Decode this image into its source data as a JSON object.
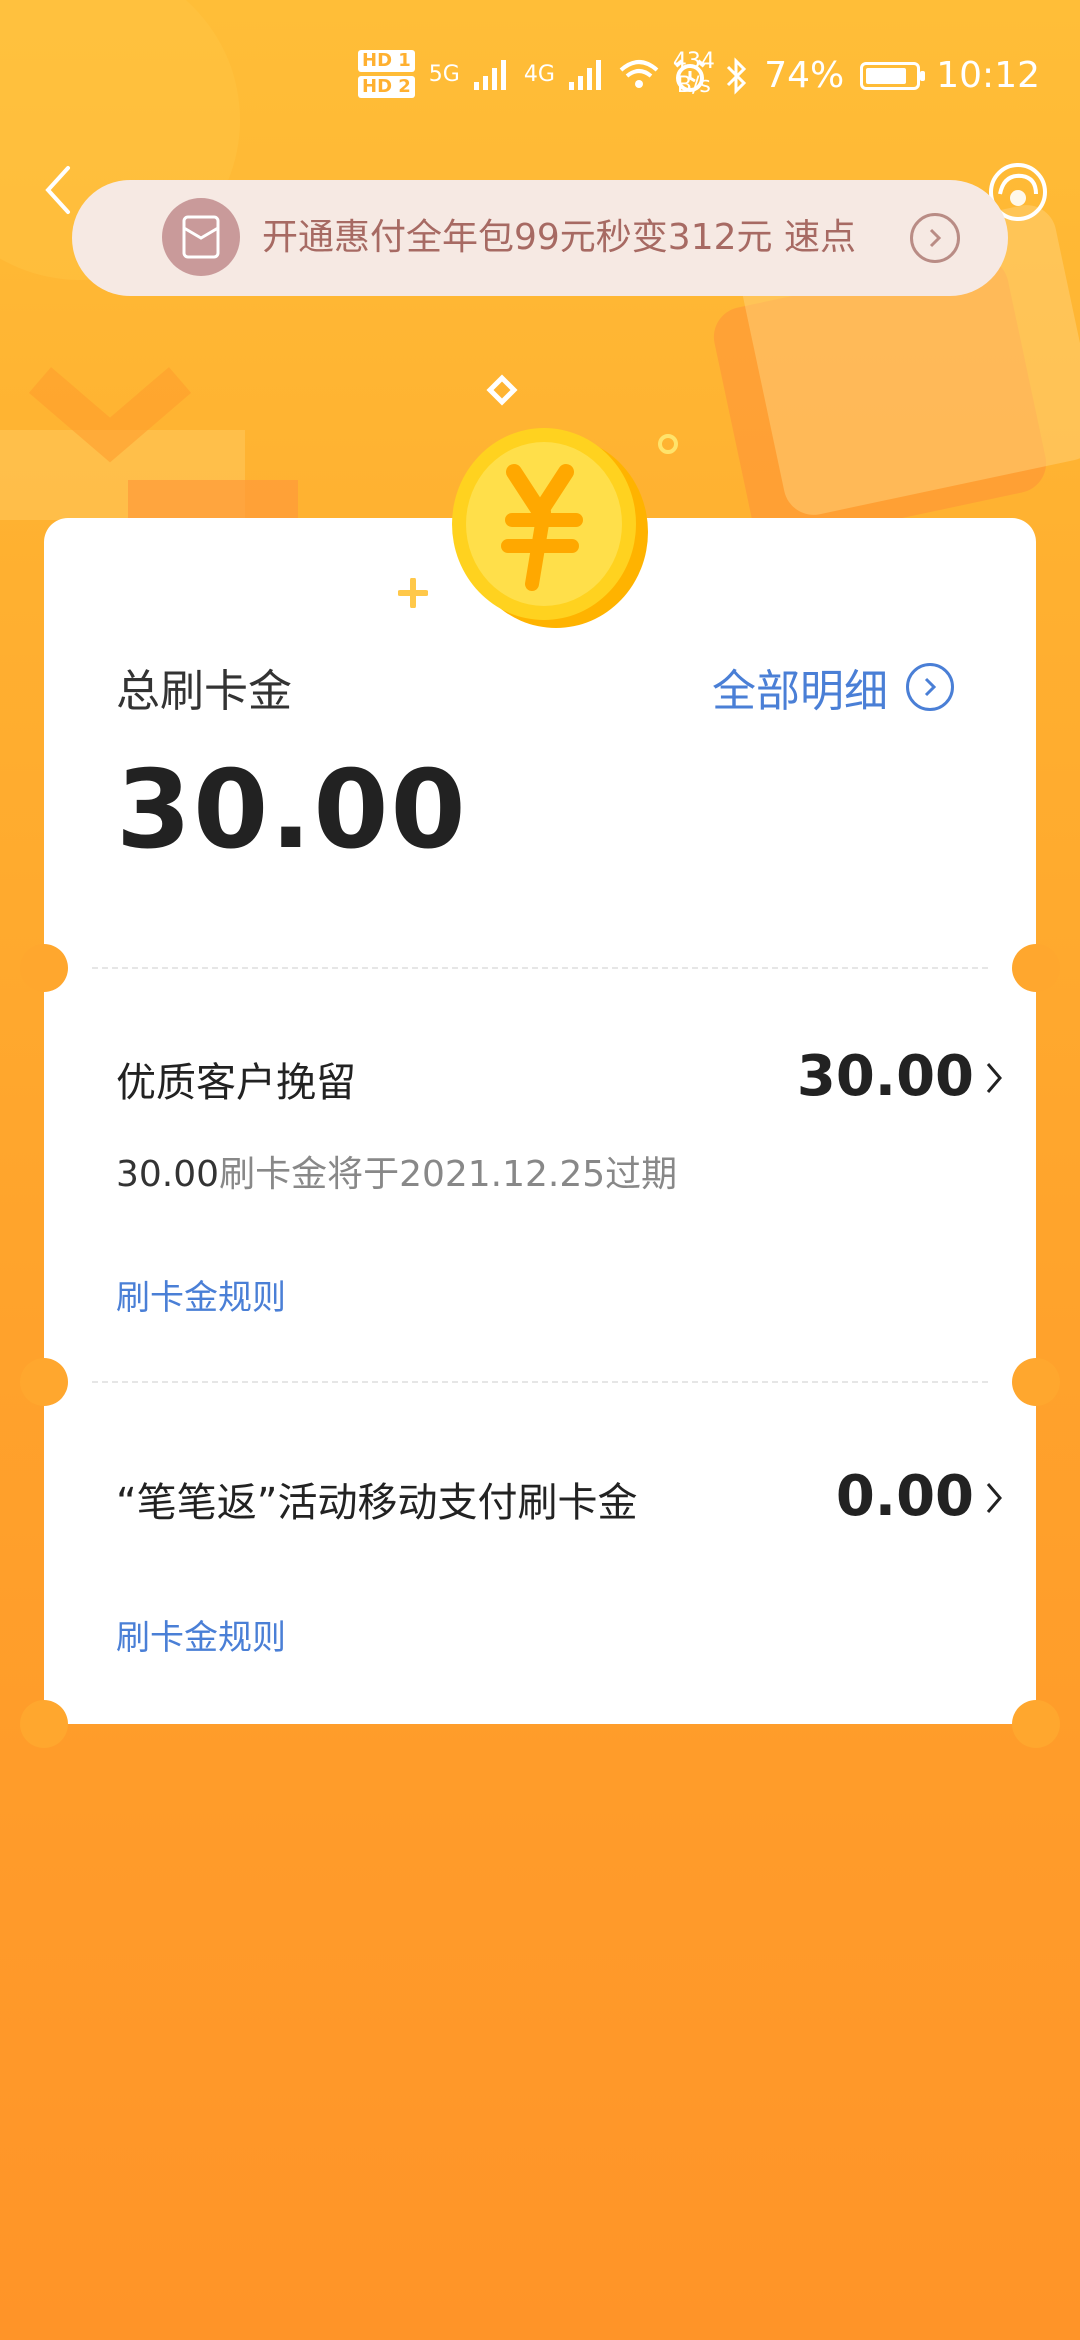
{
  "status_bar": {
    "hd1": "HD 1",
    "hd2": "HD 2",
    "net1": "5G",
    "net2": "4G",
    "speed_value": "434",
    "speed_unit": "B/s",
    "battery": "74%",
    "battery_level": 0.74,
    "time": "10:12"
  },
  "banner": {
    "text": "开通惠付全年包99元秒变312元  速点"
  },
  "summary": {
    "label": "总刷卡金",
    "detail_link": "全部明细",
    "value": "30.00"
  },
  "items": [
    {
      "title": "优质客户挽留",
      "value": "30.00",
      "expire_amount": "30.00",
      "expire_text": "刷卡金将于2021.12.25过期",
      "rule_link": "刷卡金规则"
    },
    {
      "title": "“笔笔返”活动移动支付刷卡金",
      "value": "0.00",
      "rule_link": "刷卡金规则"
    }
  ],
  "colors": {
    "accent_blue": "#4a7fd6",
    "background_orange": "#ffa72e",
    "coin_yellow": "#ffd21f"
  }
}
